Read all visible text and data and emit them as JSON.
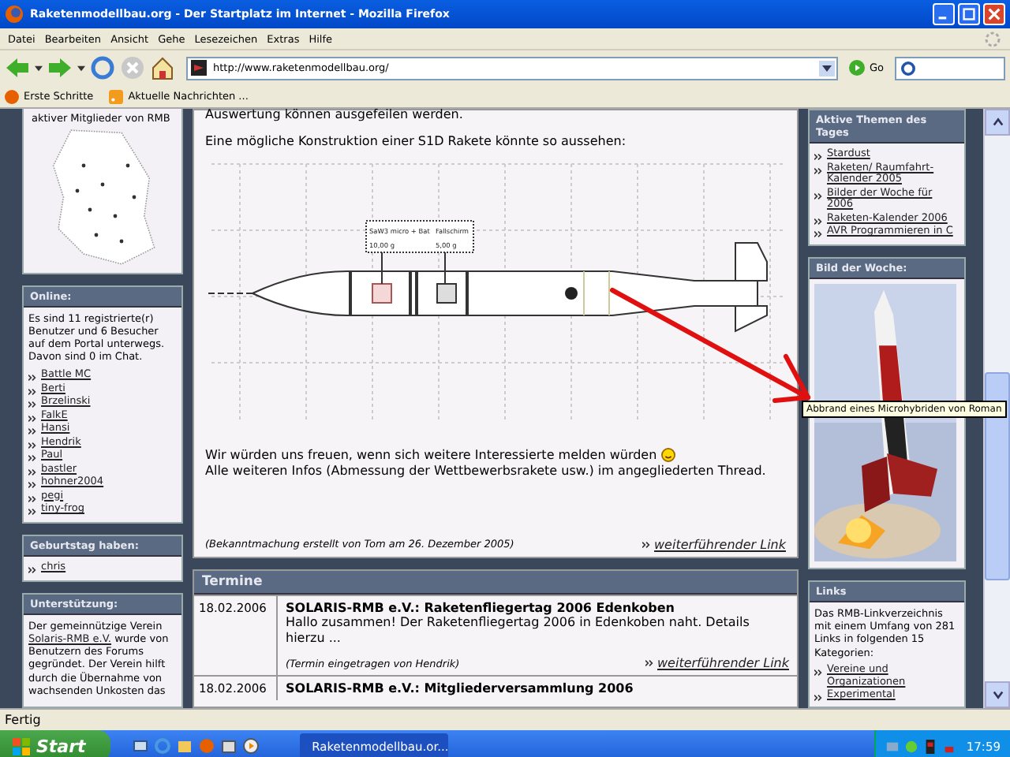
{
  "window": {
    "title": "Raketenmodellbau.org - Der Startplatz im Internet - Mozilla Firefox"
  },
  "menu": [
    "Datei",
    "Bearbeiten",
    "Ansicht",
    "Gehe",
    "Lesezeichen",
    "Extras",
    "Hilfe"
  ],
  "address": {
    "value": "http://www.raketenmodellbau.org/",
    "go": "Go"
  },
  "bookmarks": [
    "Erste Schritte",
    "Aktuelle Nachrichten ..."
  ],
  "left": {
    "map_caption": "aktiver Mitglieder von RMB",
    "online": {
      "title": "Online:",
      "text": "Es sind 11 registrierte(r) Benutzer und 6 Besucher auf dem Portal unterwegs. Davon sind 0 im Chat.",
      "users": [
        "Battle MC",
        "Berti",
        "Brzelinski",
        "FalkE",
        "Hansi",
        "Hendrik",
        "Paul",
        "bastler",
        "hohner2004",
        "pegi",
        "tiny-frog"
      ]
    },
    "birthday": {
      "title": "Geburtstag haben:",
      "users": [
        "chris"
      ]
    },
    "support": {
      "title": "Unterstützung:",
      "before": "Der gemeinnützige Verein",
      "link": "Solaris-RMB e.V.",
      "after": "wurde von Benutzern des Forums gegründet. Der Verein hilft durch die Übernahme von wachsenden Unkosten das"
    }
  },
  "announcement": {
    "cut_line": "Auswertung können ausgefeilen werden.",
    "intro": "Eine mögliche Konstruktion einer S1D Rakete könnte so aussehen:",
    "diagram_labels": [
      "SaW3 micro + Bat",
      "Fallschirm",
      "10,00 g",
      "5,00 g"
    ],
    "text1": "Wir würden uns freuen, wenn sich weitere Interessierte melden würden",
    "text2": "Alle weiteren Infos (Abmessung der Wettbewerbsrakete usw.) im angegliederten Thread.",
    "footer": "(Bekanntmachung erstellt von Tom am 26. Dezember 2005)",
    "more": "weiterführender Link"
  },
  "events": {
    "title": "Termine",
    "items": [
      {
        "date": "18.02.2006",
        "title": "SOLARIS-RMB e.V.: Raketenfliegertag 2006 Edenkoben",
        "text": "Hallo zusammen! Der Raketenfliegertag 2006 in Edenkoben naht. Details hierzu ...",
        "footer": "(Termin eingetragen von Hendrik)",
        "more": "weiterführender Link"
      },
      {
        "date": "18.02.2006",
        "title": "SOLARIS-RMB e.V.: Mitgliederversammlung 2006"
      }
    ]
  },
  "topics": {
    "title": "Aktive Themen des Tages",
    "items": [
      "Stardust",
      "Raketen/ Raumfahrt-Kalender 2005",
      "Bilder der Woche für 2006",
      "Raketen-Kalender 2006",
      "AVR Programmieren in C"
    ]
  },
  "photo": {
    "title": "Bild der Woche:"
  },
  "links": {
    "title": "Links",
    "text": "Das RMB-Linkverzeichnis mit einem Umfang von 281 Links in folgenden 15 Kategorien:",
    "items": [
      "Vereine und Organizationen",
      "Experimental"
    ]
  },
  "tooltip": "Abbrand eines Microhybriden von Roman",
  "status": "Fertig",
  "taskbar": {
    "start": "Start",
    "task": "Raketenmodellbau.or...",
    "clock": "17:59"
  }
}
